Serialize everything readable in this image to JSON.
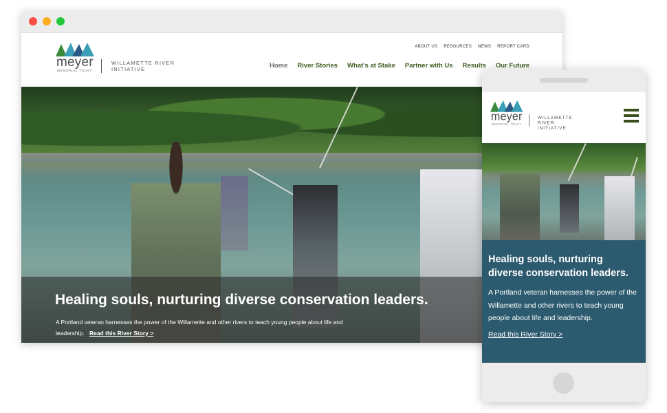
{
  "desktop": {
    "window_controls": {
      "close_color": "#fe4f45",
      "minimize_color": "#fcae22",
      "maximize_color": "#23c83b"
    },
    "logo": {
      "wordmark": "meyer",
      "trust_label": "MEMORIAL TRUST",
      "initiative_line1": "WILLAMETTE RIVER",
      "initiative_line2": "INITIATIVE",
      "mark_colors": [
        "#3b8a3a",
        "#3a9fb7",
        "#2b5a87"
      ]
    },
    "utility_nav": [
      "ABOUT US",
      "RESOURCES",
      "NEWS",
      "REPORT CARD"
    ],
    "main_nav": [
      "Home",
      "River Stories",
      "What's at Stake",
      "Partner with Us",
      "Results",
      "Our Future"
    ],
    "hero": {
      "title": "Healing souls, nurturing diverse conservation leaders.",
      "body": "A Portland veteran harnesses the power of the Willamette and other rivers to teach young people about life and leadership.",
      "link": "Read this River Story >"
    }
  },
  "mobile": {
    "logo": {
      "wordmark": "meyer",
      "trust_label": "MEMORIAL TRUST",
      "initiative_line1": "WILLAMETTE RIVER",
      "initiative_line2": "INITIATIVE"
    },
    "panel": {
      "title": "Healing souls, nurturing diverse conservation leaders.",
      "body": "A Portland veteran harnesses the power of the Willamette and other rivers to teach young people about life and leadership.",
      "link": "Read this River Story >",
      "background": "#2c5a6e"
    }
  }
}
